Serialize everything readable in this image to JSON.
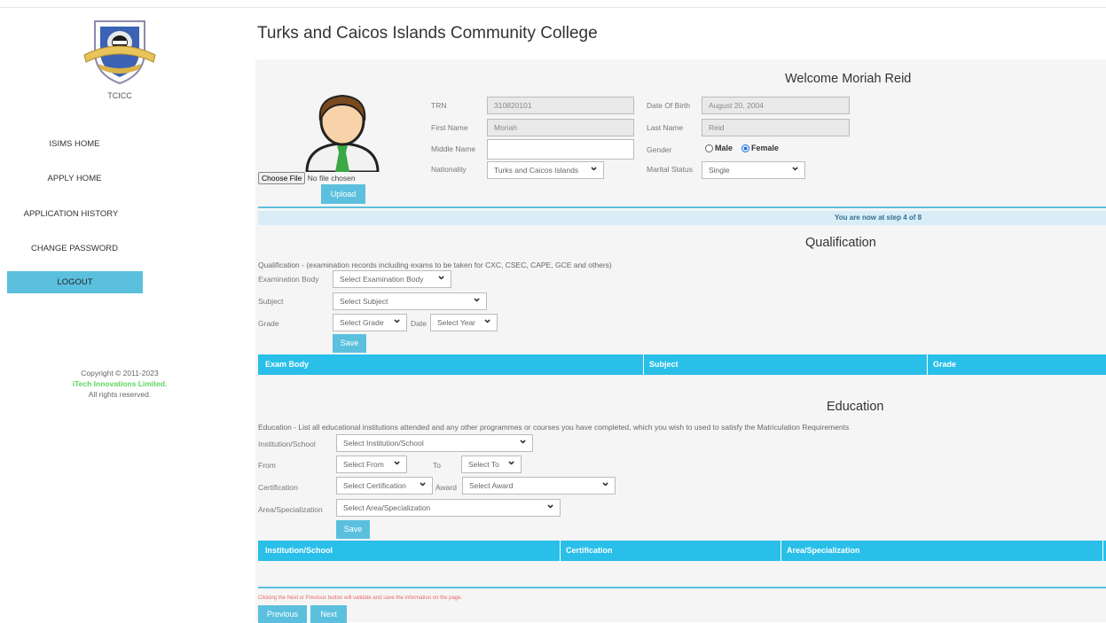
{
  "sidebar": {
    "org_short": "TCICC",
    "nav": [
      {
        "label": "ISIMS HOME"
      },
      {
        "label": "APPLY HOME"
      },
      {
        "label": "APPLICATION HISTORY"
      },
      {
        "label": "CHANGE PASSWORD"
      }
    ],
    "logout_label": "LOGOUT",
    "copyright_line": "Copyright © 2011-2023",
    "company": "iTech Innovations Limited",
    "rights": "All rights reserved."
  },
  "header": {
    "college_title": "Turks and Caicos Islands Community College",
    "welcome": "Welcome Moriah Reid"
  },
  "profile": {
    "choose_file_label": "Choose File",
    "no_file_text": "No file chosen",
    "upload_label": "Upload",
    "trn_label": "TRN",
    "trn_value": "310820101",
    "dob_label": "Date Of Birth",
    "dob_value": "August 20, 2004",
    "first_name_label": "First Name",
    "first_name_value": "Moriah",
    "last_name_label": "Last Name",
    "last_name_value": "Reid",
    "middle_name_label": "Middle Name",
    "middle_name_value": "",
    "gender_label": "Gender",
    "gender_male": "Male",
    "gender_female": "Female",
    "gender_selected": "Female",
    "nationality_label": "Nationality",
    "nationality_value": "Turks and Caicos Islands",
    "marital_label": "Marital Status",
    "marital_value": "Single"
  },
  "step_text": "You are now at step 4 of 8",
  "qualification": {
    "title": "Qualification",
    "description": "Qualification - (examination records including exams to be taken for CXC, CSEC, CAPE, GCE and others)",
    "exam_body_label": "Examination Body",
    "exam_body_value": "Select Examination Body",
    "subject_label": "Subject",
    "subject_value": "Select Subject",
    "grade_label": "Grade",
    "grade_value": "Select Grade",
    "date_label": "Date",
    "date_value": "Select Year",
    "save_label": "Save",
    "columns": [
      "Exam Body",
      "Subject",
      "Grade"
    ]
  },
  "education": {
    "title": "Education",
    "description": "Education - List all educational institutions attended and any other programmes or courses you have completed, which you wish to used to satisfy the Matriculation Requirements",
    "institution_label": "Institution/School",
    "institution_value": "Select Institution/School",
    "from_label": "From",
    "from_value": "Select From",
    "to_label": "To",
    "to_value": "Select To",
    "certification_label": "Certification",
    "certification_value": "Select Certification",
    "award_label": "Award",
    "award_value": "Select Award",
    "area_label": "Area/Specialization",
    "area_value": "Select Area/Specialization",
    "save_label": "Save",
    "columns": [
      "Institution/School",
      "Certification",
      "Area/Specialization"
    ]
  },
  "footer": {
    "note": "Clicking the Next or Previous button will validate and save the information on the page.",
    "previous_label": "Previous",
    "next_label": "Next"
  },
  "colors": {
    "accent": "#5bc0de",
    "table_header": "#29bfe9",
    "step_bar": "#d9edf7",
    "company_green": "#5cd65c"
  }
}
